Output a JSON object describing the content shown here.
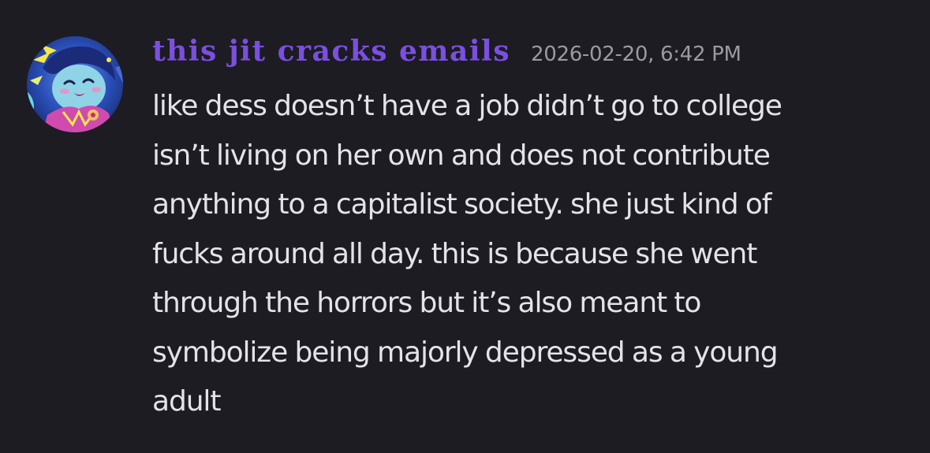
{
  "message": {
    "author": "this jit cracks emails",
    "timestamp": "2026-02-20, 6:42 PM",
    "content": "like dess doesn’t have a job didn’t go to college\nisn’t living on her own and does not contribute\nanything to a capitalist society. she just kind of\nfucks around all day. this is because she went\nthrough the horrors but it’s also meant to\nsymbolize being majorly depressed as a young\nadult"
  },
  "colors": {
    "background": "#1c1c22",
    "username": "#7b4fe0",
    "timestamp": "#9a9aa3",
    "content": "#e3e3e8"
  },
  "icons": {
    "avatar": "user-avatar-illustrated-character"
  }
}
